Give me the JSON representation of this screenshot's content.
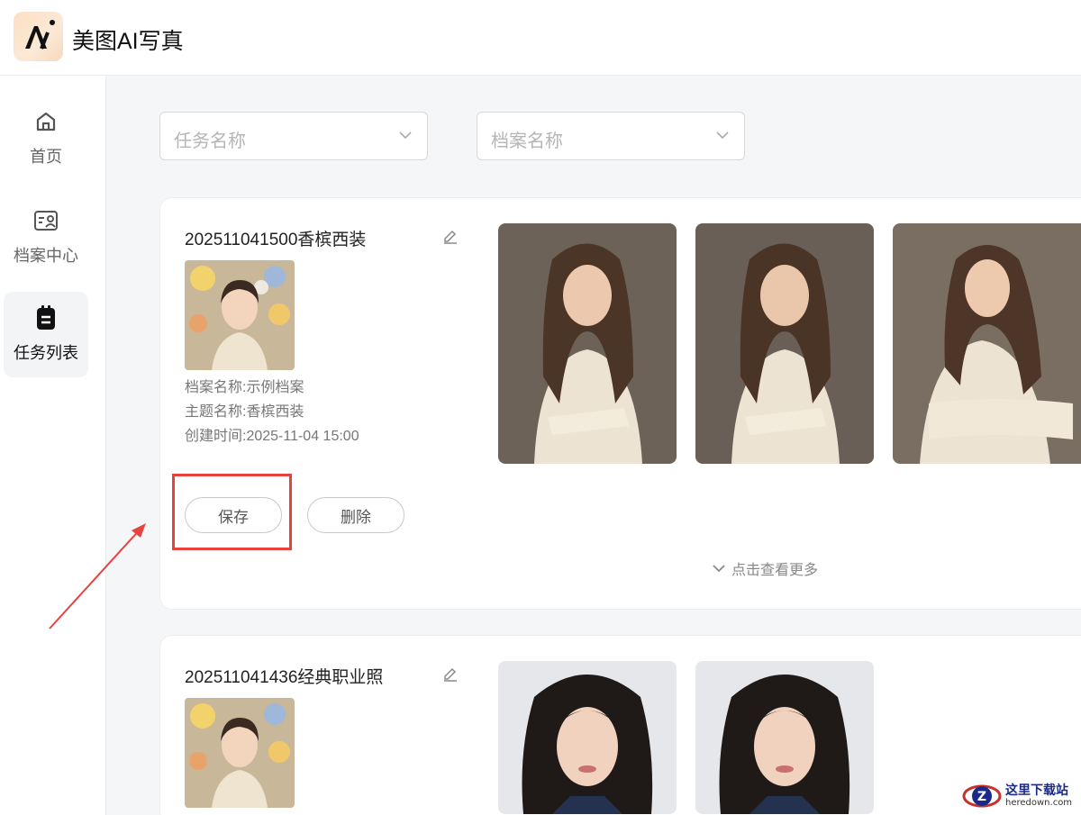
{
  "app": {
    "title": "美图AI写真",
    "logo_text": "A"
  },
  "sidebar": {
    "items": [
      {
        "label": "首页",
        "icon": "home-icon",
        "active": false
      },
      {
        "label": "档案中心",
        "icon": "profile-card-icon",
        "active": false
      },
      {
        "label": "任务列表",
        "icon": "clipboard-icon",
        "active": true
      }
    ]
  },
  "filters": {
    "task_name": {
      "placeholder": "任务名称"
    },
    "profile_name": {
      "placeholder": "档案名称"
    }
  },
  "tasks": [
    {
      "title": "202511041500香槟西装",
      "profile_name": "档案名称:示例档案",
      "theme_name": "主题名称:香槟西装",
      "created": "创建时间:2025-11-04 15:00",
      "save_label": "保存",
      "delete_label": "删除",
      "more_label": "点击查看更多",
      "photo_count": 3
    },
    {
      "title": "202511041436经典职业照",
      "photo_count": 2
    }
  ],
  "watermark": {
    "text": "这里下载站",
    "sub": "heredown.com"
  },
  "colors": {
    "highlight": "#e8423f",
    "accent_logo": "#fde0c4"
  }
}
